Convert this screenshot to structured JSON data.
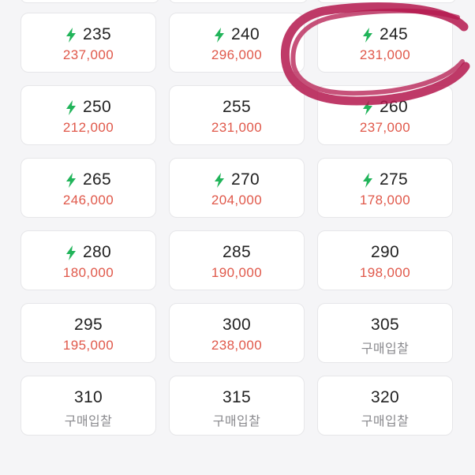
{
  "bid_label": "구매입찰",
  "colors": {
    "price": "#e0584a",
    "bolt": "#21b45a",
    "scribble": "#b4184e"
  },
  "tiles": [
    {
      "size": "235",
      "price": "237,000",
      "express": true
    },
    {
      "size": "240",
      "price": "296,000",
      "express": true
    },
    {
      "size": "245",
      "price": "231,000",
      "express": true
    },
    {
      "size": "250",
      "price": "212,000",
      "express": true
    },
    {
      "size": "255",
      "price": "231,000",
      "express": false
    },
    {
      "size": "260",
      "price": "237,000",
      "express": true
    },
    {
      "size": "265",
      "price": "246,000",
      "express": true
    },
    {
      "size": "270",
      "price": "204,000",
      "express": true
    },
    {
      "size": "275",
      "price": "178,000",
      "express": true
    },
    {
      "size": "280",
      "price": "180,000",
      "express": true
    },
    {
      "size": "285",
      "price": "190,000",
      "express": false
    },
    {
      "size": "290",
      "price": "198,000",
      "express": false
    },
    {
      "size": "295",
      "price": "195,000",
      "express": false
    },
    {
      "size": "300",
      "price": "238,000",
      "express": false
    },
    {
      "size": "305",
      "price": "구매입찰",
      "express": false
    },
    {
      "size": "310",
      "price": "구매입찰",
      "express": false
    },
    {
      "size": "315",
      "price": "구매입찰",
      "express": false
    },
    {
      "size": "320",
      "price": "구매입찰",
      "express": false
    }
  ]
}
